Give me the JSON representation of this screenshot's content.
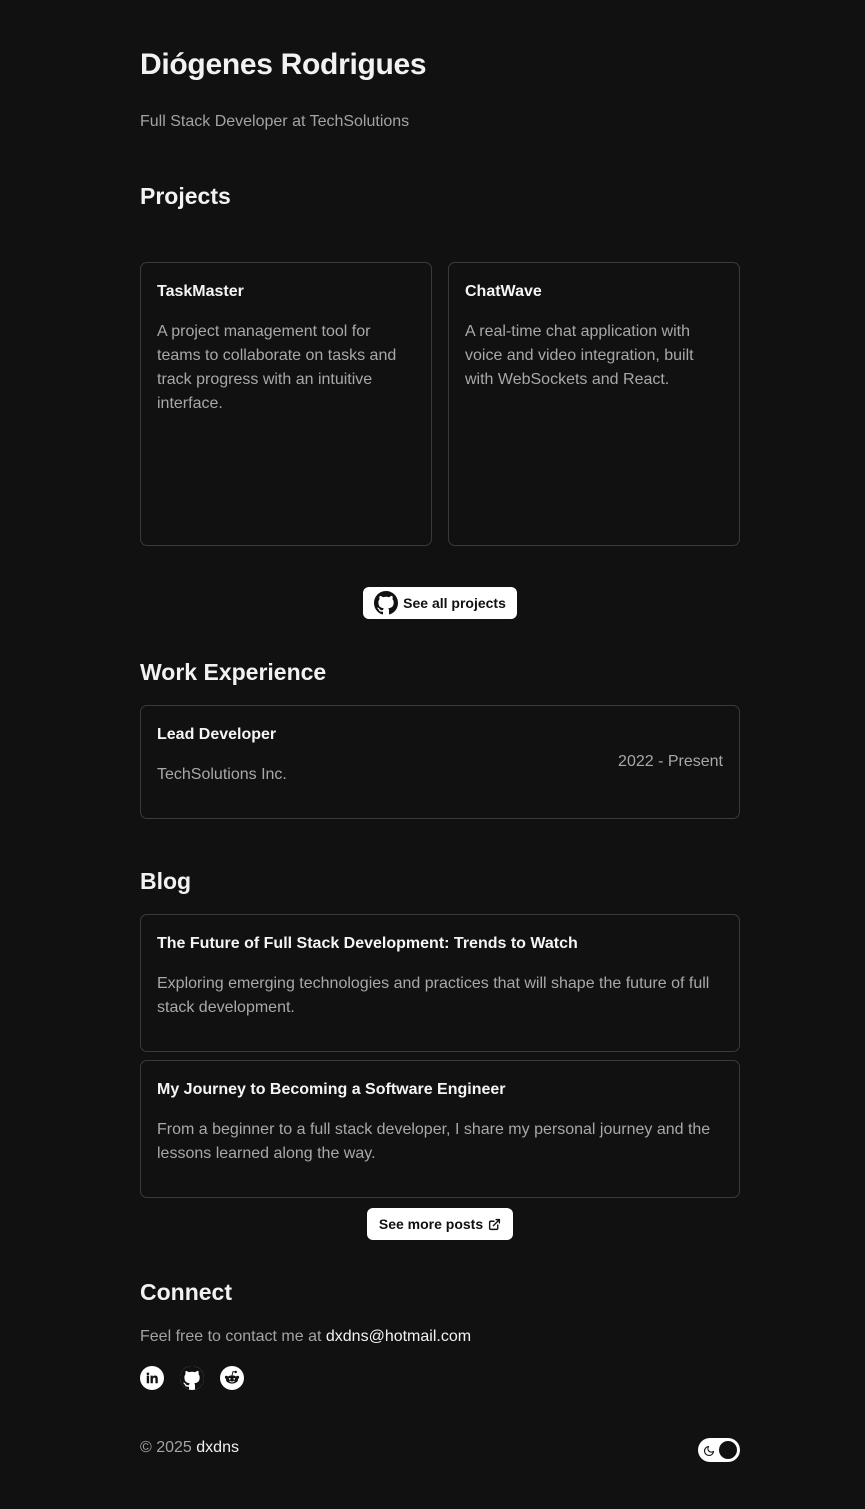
{
  "header": {
    "name": "Diógenes Rodrigues",
    "subtitle": "Full Stack Developer at TechSolutions"
  },
  "projects": {
    "title": "Projects",
    "items": [
      {
        "title": "TaskMaster",
        "description": "A project management tool for teams to collaborate on tasks and track progress with an intuitive interface."
      },
      {
        "title": "ChatWave",
        "description": "A real-time chat application with voice and video integration, built with WebSockets and React."
      }
    ],
    "see_all_label": "See all projects"
  },
  "experience": {
    "title": "Work Experience",
    "items": [
      {
        "role": "Lead Developer",
        "company": "TechSolutions Inc.",
        "period": "2022 - Present"
      }
    ]
  },
  "blog": {
    "title": "Blog",
    "posts": [
      {
        "title": "The Future of Full Stack Development: Trends to Watch",
        "excerpt": "Exploring emerging technologies and practices that will shape the future of full stack development."
      },
      {
        "title": "My Journey to Becoming a Software Engineer",
        "excerpt": "From a beginner to a full stack developer, I share my personal journey and the lessons learned along the way."
      }
    ],
    "see_more_label": "See more posts"
  },
  "connect": {
    "title": "Connect",
    "text": "Feel free to contact me at ",
    "email": "dxdns@hotmail.com",
    "socials": [
      "linkedin-icon",
      "github-icon",
      "reddit-icon"
    ]
  },
  "footer": {
    "copyright": "© 2025 ",
    "owner": "dxdns"
  },
  "theme": {
    "icon": "moon-icon",
    "background": "#111111",
    "accent": "#ffffff"
  }
}
